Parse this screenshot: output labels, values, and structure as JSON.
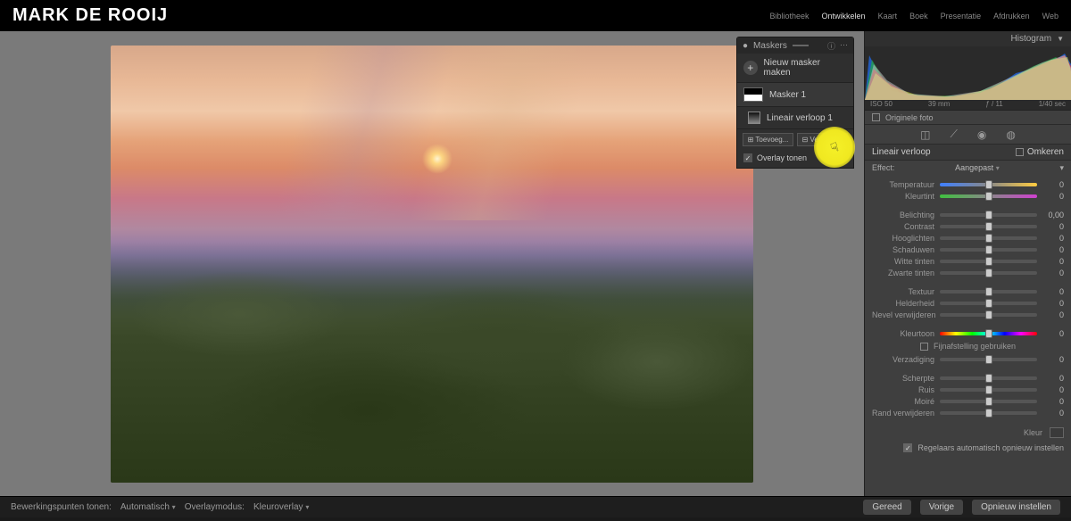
{
  "logo": "MARK DE ROOIJ",
  "topnav": [
    "Bibliotheek",
    "Ontwikkelen",
    "Kaart",
    "Boek",
    "Presentatie",
    "Afdrukken",
    "Web"
  ],
  "topnav_active_index": 1,
  "histogram": {
    "title": "Histogram",
    "meta": {
      "iso": "ISO 50",
      "focal": "39 mm",
      "aperture": "ƒ / 11",
      "shutter": "1/40 sec"
    }
  },
  "original_label": "Originele foto",
  "section": {
    "title": "Lineair verloop",
    "invert_label": "Omkeren"
  },
  "effect": {
    "label": "Effect:",
    "value": "Aangepast"
  },
  "sliders": {
    "temperatuur": {
      "label": "Temperatuur",
      "value": "0"
    },
    "kleurtint": {
      "label": "Kleurtint",
      "value": "0"
    },
    "belichting": {
      "label": "Belichting",
      "value": "0,00"
    },
    "contrast": {
      "label": "Contrast",
      "value": "0"
    },
    "hooglichten": {
      "label": "Hooglichten",
      "value": "0"
    },
    "schaduwen": {
      "label": "Schaduwen",
      "value": "0"
    },
    "wittetinten": {
      "label": "Witte tinten",
      "value": "0"
    },
    "zwartetinten": {
      "label": "Zwarte tinten",
      "value": "0"
    },
    "textuur": {
      "label": "Textuur",
      "value": "0"
    },
    "helderheid": {
      "label": "Helderheid",
      "value": "0"
    },
    "nevel": {
      "label": "Nevel verwijderen",
      "value": "0"
    },
    "kleurtoon": {
      "label": "Kleurtoon",
      "value": "0"
    },
    "verzadiging": {
      "label": "Verzadiging",
      "value": "0"
    },
    "scherpte": {
      "label": "Scherpte",
      "value": "0"
    },
    "ruis": {
      "label": "Ruis",
      "value": "0"
    },
    "moire": {
      "label": "Moiré",
      "value": "0"
    },
    "rand": {
      "label": "Rand verwijderen",
      "value": "0"
    }
  },
  "fijnafstelling": "Fijnafstelling gebruiken",
  "kleur_label": "Kleur",
  "reset_label": "Regelaars automatisch opnieuw instellen",
  "bottombar": {
    "label": "Bewerkingspunten tonen:",
    "mode1": "Automatisch",
    "mode2_label": "Overlaymodus:",
    "mode2_value": "Kleuroverlay",
    "done": "Gereed",
    "prev": "Vorige",
    "reset": "Opnieuw instellen"
  },
  "masks": {
    "title": "Maskers",
    "new": "Nieuw masker maken",
    "mask1": "Masker 1",
    "comp1": "Lineair verloop 1",
    "btn_add": "Toevoeg...",
    "btn_sub": "Verwijde...",
    "overlay_label": "Overlay tonen"
  }
}
